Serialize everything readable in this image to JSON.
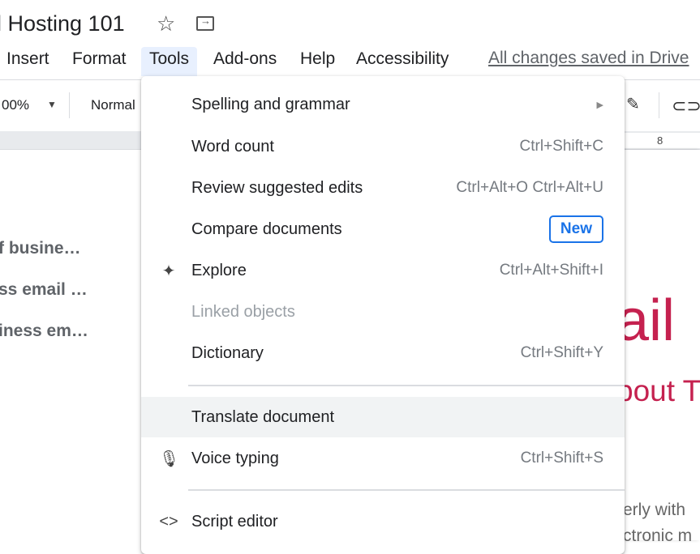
{
  "header": {
    "title": "l Hosting 101",
    "saved_status": "All changes saved in Drive"
  },
  "menubar": [
    "Insert",
    "Format",
    "Tools",
    "Add-ons",
    "Help",
    "Accessibility"
  ],
  "toolbar": {
    "zoom": "00%",
    "style": "Normal",
    "ruler_mark": "8"
  },
  "outline": [
    "f busine…",
    "ss email …",
    "iness em…"
  ],
  "doc": {
    "heading": "ail",
    "subheading": "bout T",
    "body_lines": [
      "erly with",
      "ctronic m"
    ],
    "accent_color": "#c5214f"
  },
  "tools_menu": {
    "items": [
      {
        "label": "Spelling and grammar",
        "submenu": true
      },
      {
        "label": "Word count",
        "shortcut": "Ctrl+Shift+C"
      },
      {
        "label": "Review suggested edits",
        "shortcut": "Ctrl+Alt+O Ctrl+Alt+U"
      },
      {
        "label": "Compare documents",
        "badge": "New"
      },
      {
        "label": "Explore",
        "shortcut": "Ctrl+Alt+Shift+I",
        "icon": "explore-icon"
      },
      {
        "label": "Linked objects",
        "disabled": true
      },
      {
        "label": "Dictionary",
        "shortcut": "Ctrl+Shift+Y"
      },
      {
        "label": "Translate document",
        "highlighted": true
      },
      {
        "label": "Voice typing",
        "shortcut": "Ctrl+Shift+S",
        "icon": "microphone-icon"
      },
      {
        "label": "Script editor",
        "icon": "code-icon"
      }
    ]
  }
}
